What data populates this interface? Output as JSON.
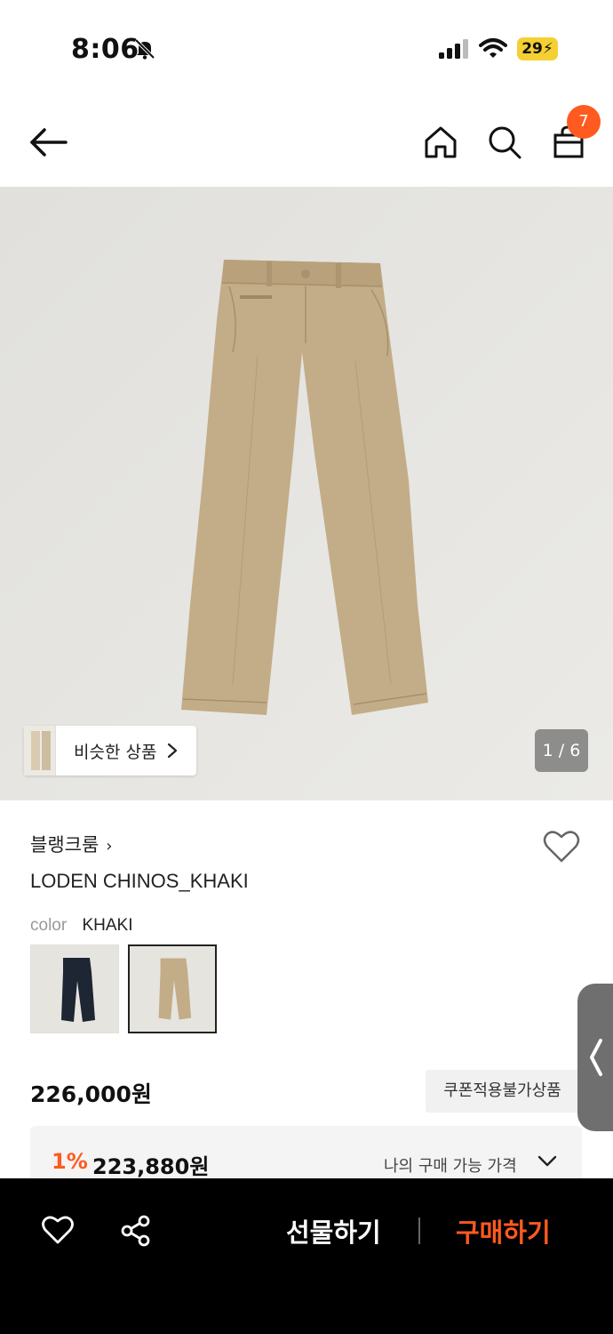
{
  "status_bar": {
    "time": "8:06",
    "battery": "29"
  },
  "nav": {
    "cart_count": "7"
  },
  "gallery": {
    "similar_label": "비슷한 상품",
    "page_counter": "1 / 6"
  },
  "product": {
    "brand": "블랭크룸",
    "name": "LODEN CHINOS_KHAKI",
    "color_label": "color",
    "color_value": "KHAKI",
    "price": "226,000원",
    "coupon_tag": "쿠폰적용불가상품",
    "benefit_percent": "1%",
    "benefit_price": "223,880원",
    "benefit_label": "나의 구매 가능 가격"
  },
  "bottom_bar": {
    "gift_label": "선물하기",
    "buy_label": "구매하기"
  },
  "colors": {
    "accent": "#ff5a1f",
    "khaki": "#c3ac88",
    "navy": "#1e2533"
  },
  "icons": [
    "back-arrow-icon",
    "home-icon",
    "search-icon",
    "shopping-bag-icon",
    "heart-icon",
    "share-icon",
    "chevron-down-icon",
    "chevron-right-icon",
    "bell-off-icon"
  ]
}
